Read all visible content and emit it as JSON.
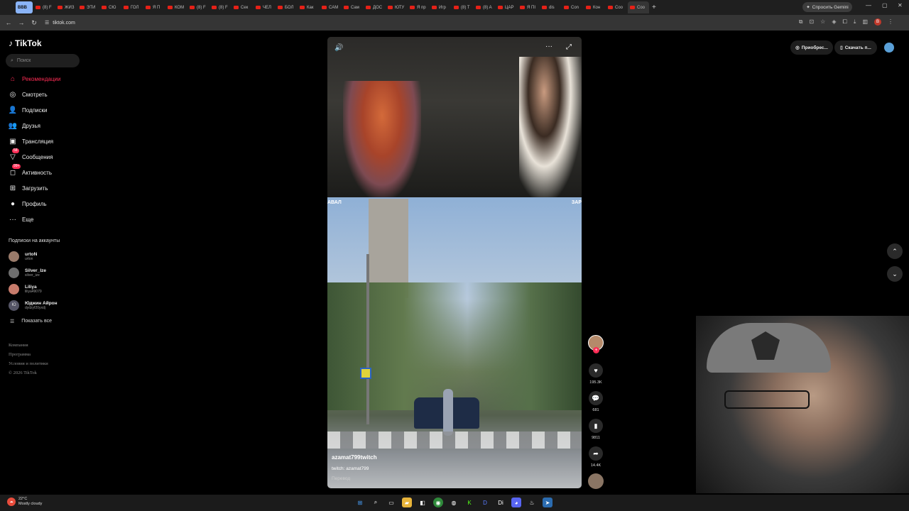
{
  "browser": {
    "tabs": [
      "BBB",
      "(8) F",
      "ЖИЗ",
      "ЭТИ",
      "СЮ",
      "ГОЛ",
      "Я П",
      "КОМ",
      "(8) F",
      "(8) F",
      "Сек",
      "ЧЕЛ",
      "БОЛ",
      "Как",
      "САМ",
      "Сам",
      "ДОС",
      "ЮТУ",
      "Я пр",
      "Игр",
      "(8) T",
      "(8) A",
      "ЦАР",
      "Я ПІ",
      "dis",
      "Con",
      "Кон",
      "Coo",
      "Coo"
    ],
    "gemini_label": "Спросить Gemini",
    "url": "tiktok.com"
  },
  "sidebar": {
    "logo": "TikTok",
    "search_placeholder": "Поиск",
    "menu": [
      {
        "label": "Рекомендации",
        "icon": "home-icon",
        "glyph": "⌂",
        "active": true,
        "badge": ""
      },
      {
        "label": "Смотреть",
        "icon": "compass-icon",
        "glyph": "◎",
        "active": false,
        "badge": ""
      },
      {
        "label": "Подписки",
        "icon": "following-icon",
        "glyph": "👤",
        "active": false,
        "badge": ""
      },
      {
        "label": "Друзья",
        "icon": "friends-icon",
        "glyph": "👥",
        "active": false,
        "badge": ""
      },
      {
        "label": "Трансляция",
        "icon": "live-icon",
        "glyph": "▣",
        "active": false,
        "badge": ""
      },
      {
        "label": "Сообщения",
        "icon": "messages-icon",
        "glyph": "▽",
        "active": false,
        "badge": "58"
      },
      {
        "label": "Активность",
        "icon": "activity-icon",
        "glyph": "◻",
        "active": false,
        "badge": "99+"
      },
      {
        "label": "Загрузить",
        "icon": "upload-icon",
        "glyph": "⊞",
        "active": false,
        "badge": ""
      },
      {
        "label": "Профиль",
        "icon": "profile-icon",
        "glyph": "●",
        "active": false,
        "badge": ""
      },
      {
        "label": "Еще",
        "icon": "more-icon",
        "glyph": "···",
        "active": false,
        "badge": ""
      }
    ],
    "following_title": "Подписки на аккаунты",
    "following": [
      {
        "name": "urtoN",
        "user": "urton",
        "initial": ""
      },
      {
        "name": "Silver_Ize",
        "user": "silver_ize",
        "initial": ""
      },
      {
        "name": "Liliya",
        "user": "liliya49079",
        "initial": ""
      },
      {
        "name": "Юджин Айрон",
        "user": "dydzyf20yxdj",
        "initial": "Ю"
      }
    ],
    "show_all": "Показать все",
    "footer": [
      "Компания",
      "Программа",
      "Условия и политики",
      "© 2026 TikTok"
    ]
  },
  "video": {
    "username": "azamat799twitch",
    "description": "twitch: azamat799",
    "translate": "Перевод",
    "overlay_left": "АВАЛ",
    "overlay_right": "ЗАР"
  },
  "actions": {
    "likes": "195.3K",
    "comments": "681",
    "saves": "9811",
    "shares": "14.4K"
  },
  "topright": {
    "promo": "Приобрес...",
    "download": "Скачать п..."
  },
  "taskbar": {
    "temp": "22°C",
    "weather": "Mostly cloudy"
  },
  "colors": {
    "accent": "#fe2c55",
    "background": "#000000"
  }
}
